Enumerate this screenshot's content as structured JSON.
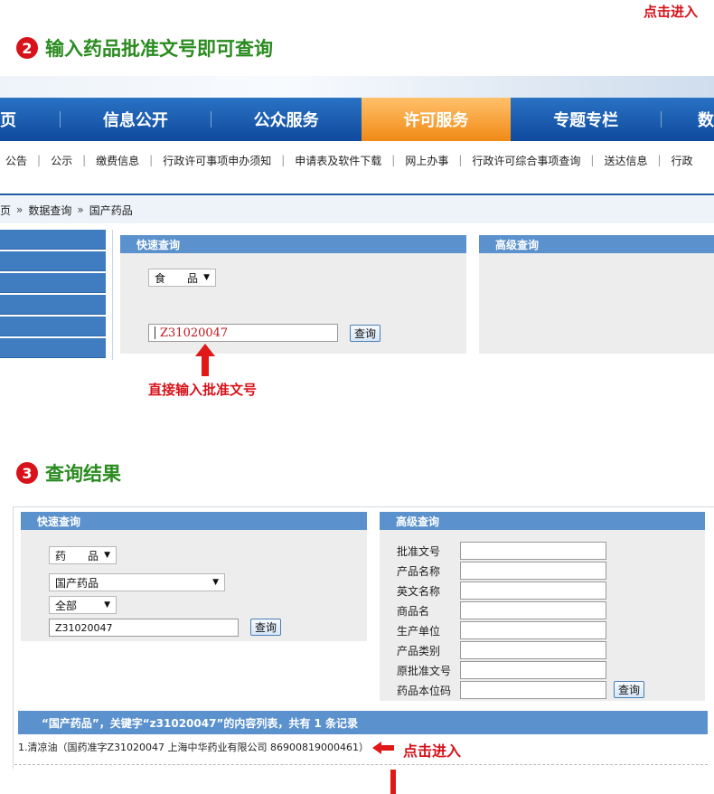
{
  "top_hint": "点击进入",
  "step2": {
    "num": "2",
    "title": "输入药品批准文号即可查询"
  },
  "nav": {
    "items": [
      {
        "label": "页",
        "active": false
      },
      {
        "label": "信息公开",
        "active": false
      },
      {
        "label": "公众服务",
        "active": false
      },
      {
        "label": "许可服务",
        "active": true
      },
      {
        "label": "专题专栏",
        "active": false
      },
      {
        "label": "数",
        "active": false
      }
    ]
  },
  "subnav": [
    "公告",
    "公示",
    "缴费信息",
    "行政许可事项申办须知",
    "申请表及软件下载",
    "网上办事",
    "行政许可综合事项查询",
    "送达信息",
    "行政"
  ],
  "breadcrumb": [
    "页",
    "数据查询",
    "国产药品"
  ],
  "breadcrumb_sep": "»",
  "quick1": {
    "header": "快速查询",
    "select": "食　　品",
    "input": "Z31020047",
    "button": "查询"
  },
  "advanced1": {
    "header": "高级查询"
  },
  "annotation1": "直接输入批准文号",
  "step3": {
    "num": "3",
    "title": "查询结果"
  },
  "quick2": {
    "header": "快速查询",
    "select1": "药　　品",
    "select2": "国产药品",
    "select3": "全部",
    "input": "Z31020047",
    "button": "查询"
  },
  "advanced2": {
    "header": "高级查询",
    "fields": [
      "批准文号",
      "产品名称",
      "英文名称",
      "商品名",
      "生产单位",
      "产品类别",
      "原批准文号",
      "药品本位码"
    ],
    "button": "查询"
  },
  "result": {
    "summary": "“国产药品”，关键字“z31020047”的内容列表，共有 1 条记录",
    "row": "1.清凉油（国药准字Z31020047 上海中华药业有限公司 86900819000461）",
    "hint": "点击进入"
  },
  "colors": {
    "accent_red": "#d7121a",
    "title_green": "#2a8b1f",
    "nav_blue": "#1b5aa8",
    "active_orange": "#f18a16"
  }
}
